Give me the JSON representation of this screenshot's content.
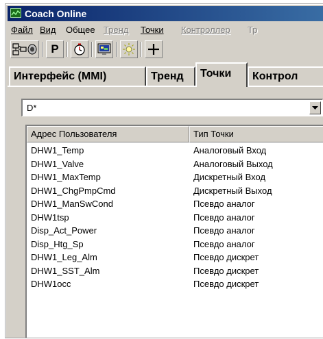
{
  "window": {
    "title": "Coach Online",
    "icon": "chart-window-icon"
  },
  "menu": [
    {
      "label": "Файл",
      "enabled": true
    },
    {
      "label": "Вид",
      "enabled": true
    },
    {
      "label": "Общее",
      "enabled": true
    },
    {
      "label": "Тренд",
      "enabled": false
    },
    {
      "label": "Точки",
      "enabled": true
    },
    {
      "label": "Контроллер",
      "enabled": false
    },
    {
      "label": "Тр",
      "enabled": false
    }
  ],
  "toolbar": {
    "buttons": [
      {
        "icon": "network-connect-icon"
      },
      {
        "icon": "disk-drive-icon"
      },
      {
        "icon": "p-letter-icon",
        "label": "P"
      },
      {
        "icon": "stopwatch-icon"
      },
      {
        "icon": "monitor-screen-icon"
      },
      {
        "icon": "light-bulb-icon"
      },
      {
        "icon": "plus-icon"
      }
    ]
  },
  "tabs": [
    {
      "label": "Интерфейс (MMI)",
      "active": false
    },
    {
      "label": "Тренд",
      "active": false
    },
    {
      "label": "Точки",
      "active": true
    },
    {
      "label": "Контрол",
      "active": false
    }
  ],
  "filter": {
    "value": "D*"
  },
  "table": {
    "columns": [
      "Адрес Пользователя",
      "Тип Точки"
    ],
    "rows": [
      [
        "DHW1_Temp",
        "Аналоговый Вход"
      ],
      [
        "DHW1_Valve",
        "Аналоговый Выход"
      ],
      [
        "DHW1_MaxTemp",
        "Дискретный Вход"
      ],
      [
        "DHW1_ChgPmpCmd",
        "Дискретный Выход"
      ],
      [
        "DHW1_ManSwCond",
        "Псевдо аналог"
      ],
      [
        "DHW1tsp",
        "Псевдо аналог"
      ],
      [
        "Disp_Act_Power",
        "Псевдо аналог"
      ],
      [
        "Disp_Htg_Sp",
        "Псевдо аналог"
      ],
      [
        "DHW1_Leg_Alm",
        "Псевдо дискрет"
      ],
      [
        "DHW1_SST_Alm",
        "Псевдо дискрет"
      ],
      [
        "DHW1occ",
        "Псевдо дискрет"
      ]
    ]
  },
  "colors": {
    "title_bar_start": "#0a246a",
    "title_bar_end": "#3a6ea5",
    "window_face": "#d4d0c8",
    "disabled_text": "#808080"
  }
}
